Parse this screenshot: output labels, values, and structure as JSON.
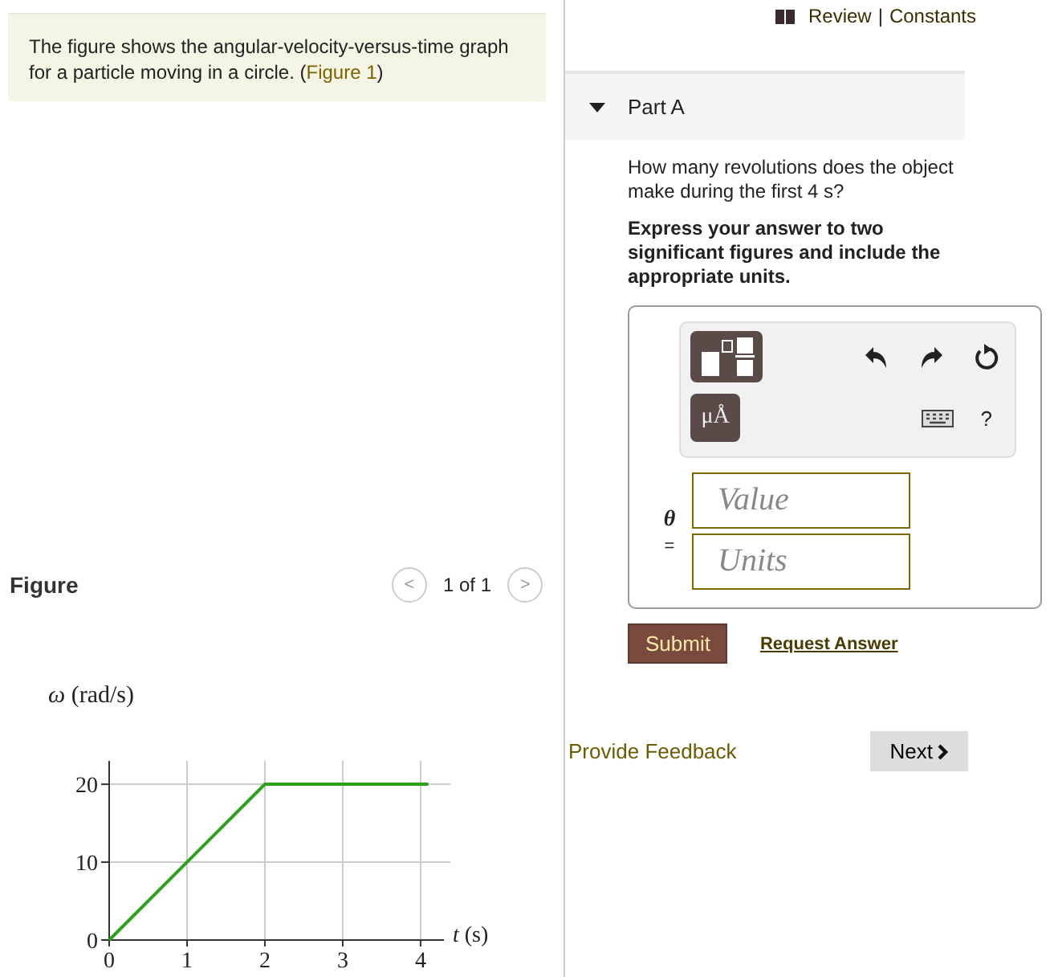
{
  "intro": {
    "before": "The figure shows the angular-velocity-versus-time graph for a particle moving in a circle. (",
    "link": "Figure 1",
    "after": ")"
  },
  "figure": {
    "heading": "Figure",
    "prev": "<",
    "pager": "1 of 1",
    "next": ">",
    "chart_data": {
      "type": "line",
      "ylabel": "*ω* (rad/s)",
      "xlabel": "*t* (s)",
      "x": [
        0,
        2,
        4.1
      ],
      "series": [
        {
          "color": "#2ea01e",
          "values": [
            0,
            20,
            20
          ]
        }
      ],
      "xlim": [
        0,
        4.3
      ],
      "ylim": [
        0,
        23
      ],
      "grid": true,
      "xticks": [
        0,
        1,
        2,
        3,
        4
      ],
      "yticks": [
        0,
        10,
        20
      ]
    }
  },
  "header_links": {
    "review": "Review",
    "separator": "|",
    "constants": "Constants"
  },
  "part": {
    "title": "Part A",
    "expanded": true
  },
  "question": "How many revolutions does the object make during the first 4 s?",
  "instruction": "Express your answer to two significant figures and include the appropriate units.",
  "toolbar": {
    "units_button": "μÅ",
    "help": "?"
  },
  "answer": {
    "variable": "θ",
    "equals": "=",
    "value_placeholder": "Value",
    "units_placeholder": "Units"
  },
  "submit": "Submit",
  "request_answer": "Request Answer",
  "feedback": "Provide Feedback",
  "next": "Next"
}
